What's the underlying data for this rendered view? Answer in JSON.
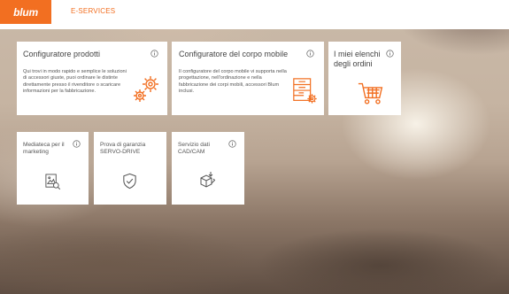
{
  "header": {
    "logo_text": "blum",
    "nav_label": "E-SERVICES"
  },
  "colors": {
    "accent": "#f26f21",
    "tile_bg": "#ffffff",
    "text": "#444444"
  },
  "tiles": [
    {
      "title": "Configuratore prodotti",
      "description": "Qui trovi in modo rapido e semplice le soluzioni di accessori giuste, puoi ordinare le distinte direttamente presso il rivenditore o scaricare informazioni per la fabbricazione.",
      "icon": "gears-icon",
      "info_icon": "info-icon"
    },
    {
      "title": "Configuratore del corpo mobile",
      "description": "Il configuratore del corpo mobile vi supporta nella progettazione, nell'ordinazione e nella fabbricazione dei corpi mobili, accessori Blum inclusi.",
      "icon": "cabinet-config-icon",
      "info_icon": "info-icon"
    },
    {
      "title": "I miei elenchi degli ordini",
      "icon": "shopping-cart-icon",
      "info_icon": "info-icon"
    },
    {
      "title": "Mediateca per il marketing",
      "icon": "media-search-icon",
      "info_icon": "info-icon"
    },
    {
      "title": "Prova di garanzia SERVO-DRIVE",
      "icon": "shield-check-icon",
      "info_icon": "info-icon"
    },
    {
      "title": "Servizio dati CAD/CAM",
      "icon": "cad-cube-icon",
      "info_icon": "info-icon"
    }
  ]
}
